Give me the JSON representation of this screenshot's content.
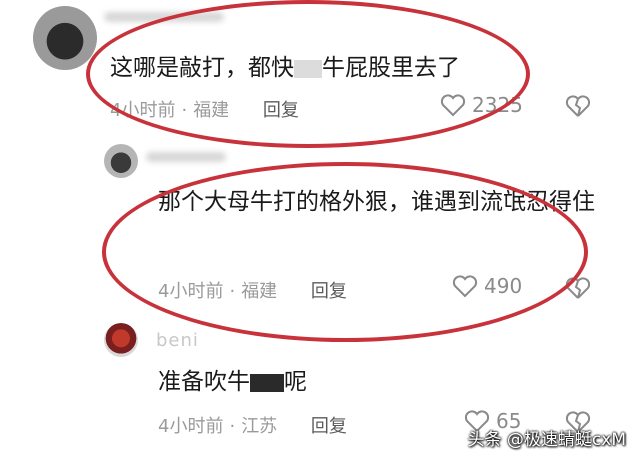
{
  "comments": [
    {
      "text_a": "这哪是敲打，都快",
      "text_b": "牛屁股里去了",
      "time": "4小时前",
      "location": "福建",
      "reply_label": "回复",
      "likes": "2325",
      "like_icon": "heart-outline-icon",
      "dislike_icon": "broken-heart-icon"
    },
    {
      "text": "那个大母牛打的格外狠，谁遇到流氓忍得住",
      "time": "4小时前",
      "location": "福建",
      "reply_label": "回复",
      "likes": "490",
      "like_icon": "heart-outline-icon",
      "dislike_icon": "broken-heart-icon"
    },
    {
      "username": "beni",
      "text_a": "准备吹牛",
      "text_b": "呢",
      "time": "4小时前",
      "location": "江苏",
      "reply_label": "回复",
      "likes": "65",
      "like_icon": "heart-outline-icon",
      "dislike_icon": "broken-heart-icon"
    }
  ],
  "watermark": "头条 @极速蜻蜓cxM",
  "colors": {
    "annotation_red": "#c8323b",
    "text": "#1a1a1a",
    "meta": "#9a9a9a"
  }
}
